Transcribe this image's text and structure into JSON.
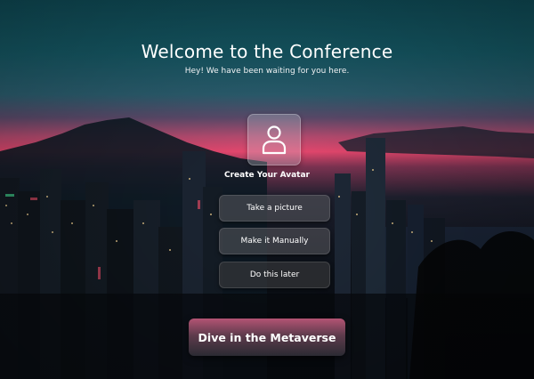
{
  "hero": {
    "title": "Welcome to the Conference",
    "subtitle": "Hey! We have been waiting for you here."
  },
  "avatar": {
    "icon": "user-icon",
    "label": "Create Your Avatar"
  },
  "options": [
    {
      "label": "Take a picture"
    },
    {
      "label": "Make it Manually"
    },
    {
      "label": "Do this later"
    }
  ],
  "cta": {
    "label": "Dive in the Metaverse"
  },
  "colors": {
    "sky_top": "#0f4a55",
    "sunset_pink": "#e1466c",
    "cta_top": "#b45474",
    "cta_bottom": "#2b2b33"
  }
}
